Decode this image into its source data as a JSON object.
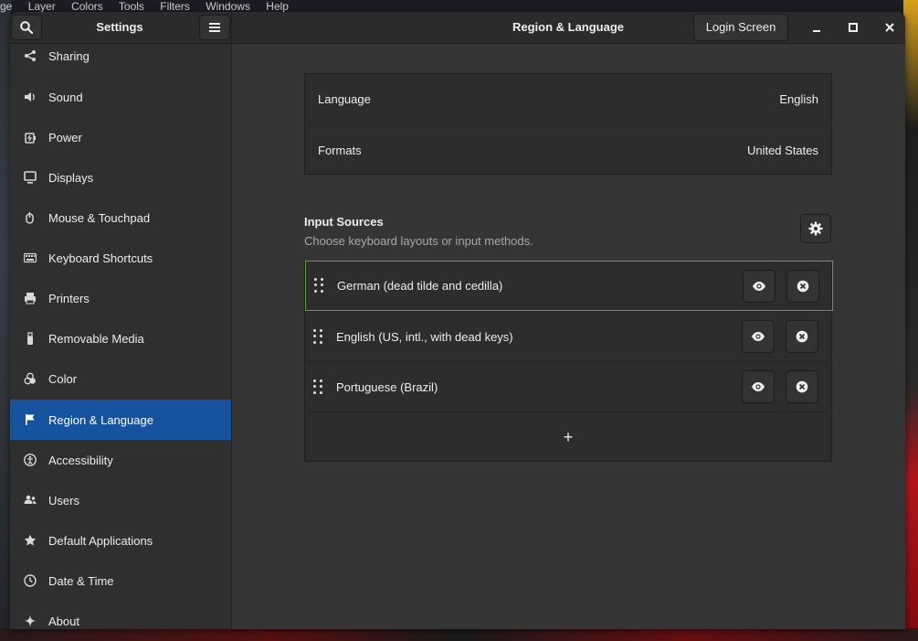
{
  "background": {
    "menubar": [
      "ge",
      "Layer",
      "Colors",
      "Tools",
      "Filters",
      "Windows",
      "Help"
    ]
  },
  "header": {
    "sidebar_title": "Settings",
    "page_title": "Region & Language",
    "login_screen_label": "Login Screen",
    "search_icon": "search-icon",
    "menu_icon": "hamburger-icon"
  },
  "sidebar": {
    "items": [
      {
        "label": "Sharing",
        "icon": "share-icon"
      },
      {
        "label": "Sound",
        "icon": "speaker-icon"
      },
      {
        "label": "Power",
        "icon": "power-icon"
      },
      {
        "label": "Displays",
        "icon": "display-icon"
      },
      {
        "label": "Mouse & Touchpad",
        "icon": "mouse-icon"
      },
      {
        "label": "Keyboard Shortcuts",
        "icon": "keyboard-icon"
      },
      {
        "label": "Printers",
        "icon": "printer-icon"
      },
      {
        "label": "Removable Media",
        "icon": "usb-icon"
      },
      {
        "label": "Color",
        "icon": "color-icon"
      },
      {
        "label": "Region & Language",
        "icon": "flag-icon",
        "active": true
      },
      {
        "label": "Accessibility",
        "icon": "accessibility-icon"
      },
      {
        "label": "Users",
        "icon": "users-icon"
      },
      {
        "label": "Default Applications",
        "icon": "star-icon"
      },
      {
        "label": "Date & Time",
        "icon": "clock-icon"
      },
      {
        "label": "About",
        "icon": "sparkle-icon"
      }
    ],
    "active_color": "#15539e"
  },
  "main": {
    "language": {
      "label": "Language",
      "value": "English"
    },
    "formats": {
      "label": "Formats",
      "value": "United States"
    },
    "input_sources": {
      "title": "Input Sources",
      "subtitle": "Choose keyboard layouts or input methods.",
      "items": [
        {
          "label": "German (dead tilde and cedilla)",
          "selected": true
        },
        {
          "label": "English (US, intl., with dead keys)",
          "selected": false
        },
        {
          "label": "Portuguese (Brazil)",
          "selected": false
        }
      ],
      "add_label": "+"
    },
    "selection_color": "#5fa52a"
  }
}
